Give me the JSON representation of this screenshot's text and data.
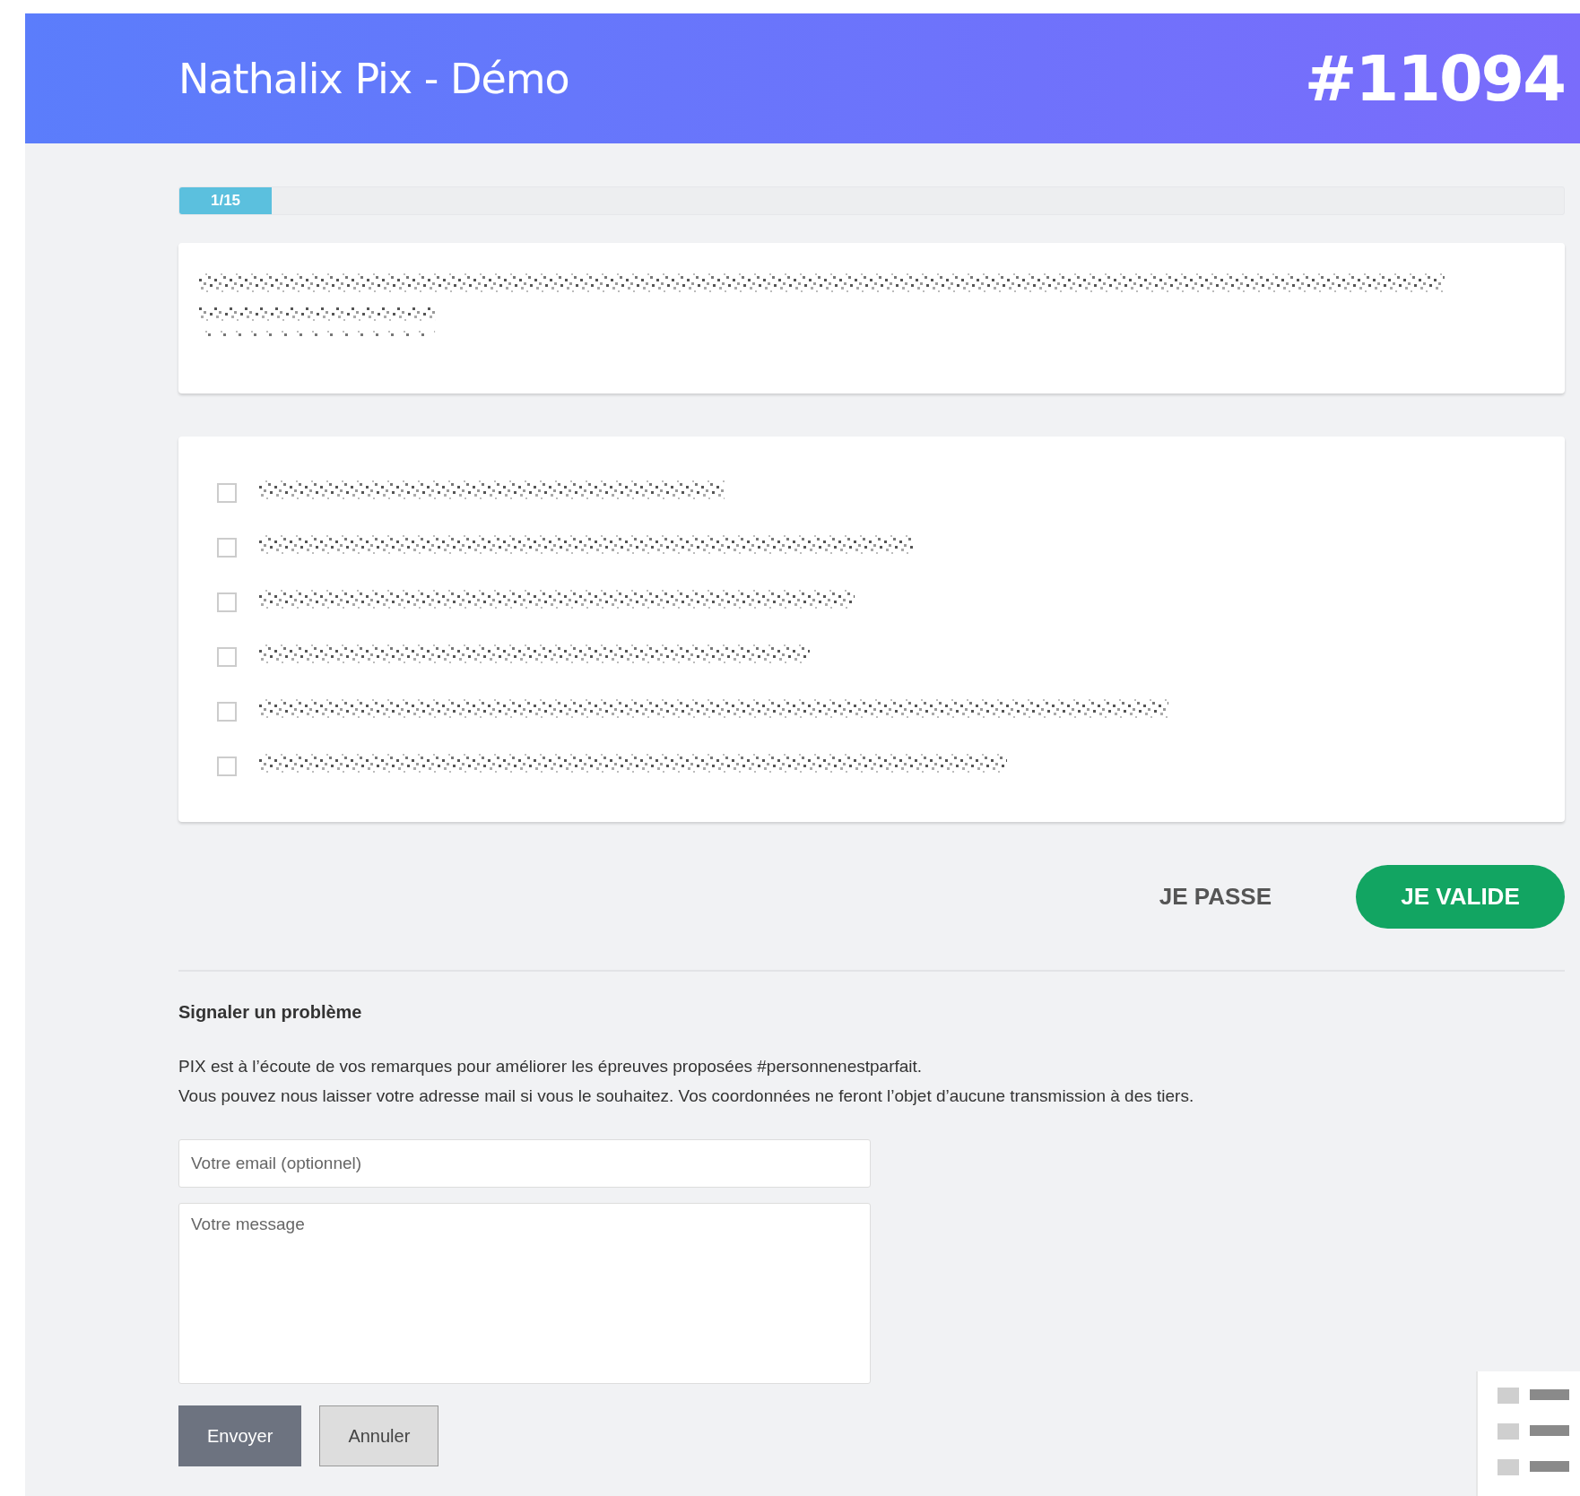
{
  "header": {
    "title": "Nathalix Pix - Démo",
    "code": "#11094"
  },
  "progress": {
    "label": "1/15",
    "level": 0.06
  },
  "answers": [
    {
      "checked": false
    },
    {
      "checked": false
    },
    {
      "checked": false
    },
    {
      "checked": false
    },
    {
      "checked": false
    },
    {
      "checked": false
    }
  ],
  "actions": {
    "skip": "JE PASSE",
    "validate": "JE VALIDE"
  },
  "feedback": {
    "title": "Signaler un problème",
    "lines": [
      "PIX est à l’écoute de vos remarques pour améliorer les épreuves proposées #personnenestparfait.",
      "Vous pouvez nous laisser votre adresse mail si vous le souhaitez. Vos coordonnées ne feront l’objet d’aucune transmission à des tiers."
    ],
    "email": {
      "placeholder": "Votre email (optionnel)"
    },
    "message": {
      "placeholder": "Votre message"
    },
    "buttons": [
      {
        "label": "Envoyer",
        "kind": "primary"
      },
      {
        "label": "Annuler",
        "kind": "secondary"
      }
    ]
  }
}
